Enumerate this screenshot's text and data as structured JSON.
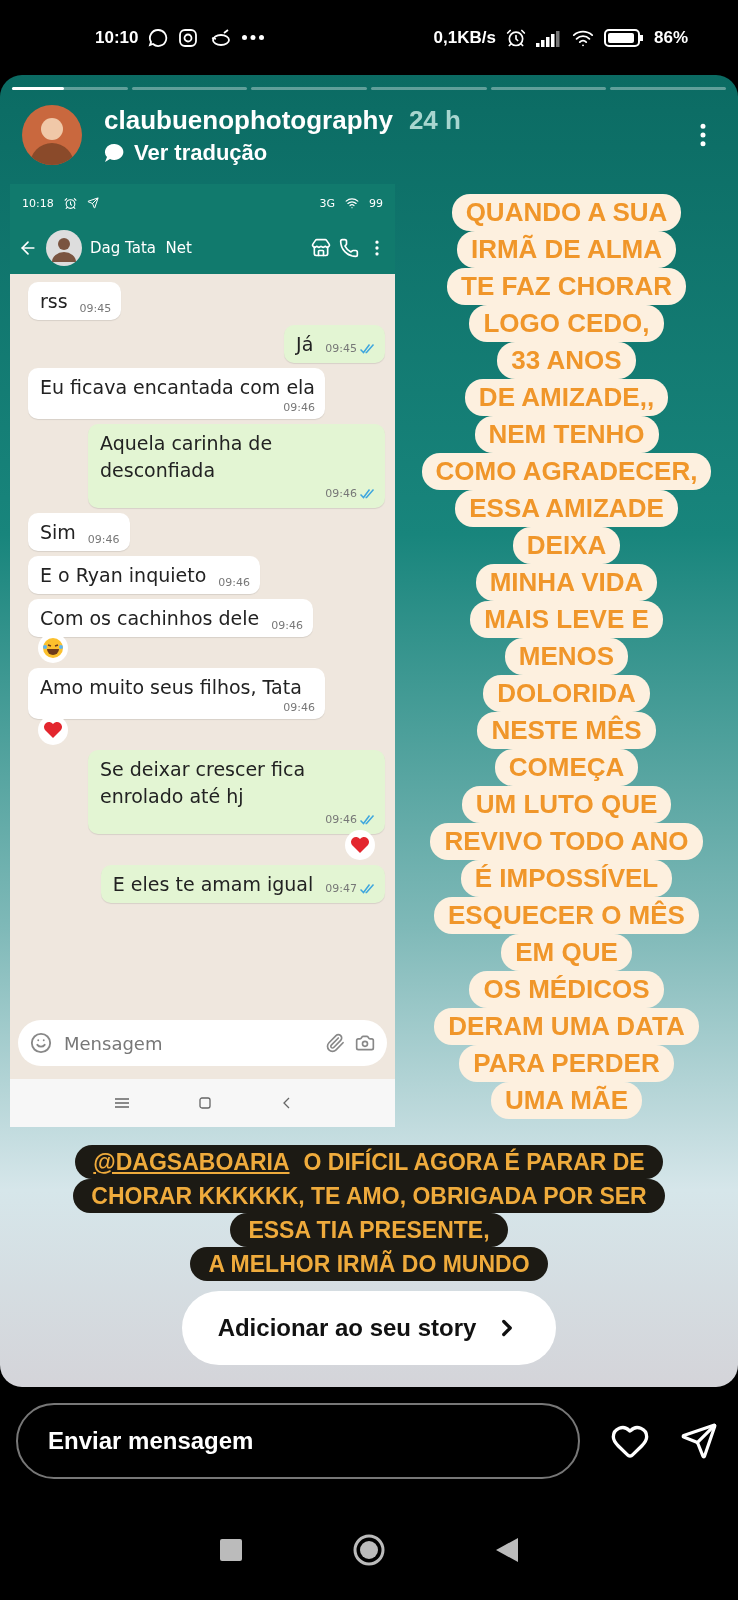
{
  "status_bar": {
    "time": "10:10",
    "speed": "0,1KB/s",
    "battery": "86%"
  },
  "story": {
    "progress": [
      {
        "level": 0.45
      },
      {
        "level": 0
      },
      {
        "level": 0
      },
      {
        "level": 0
      },
      {
        "level": 0
      },
      {
        "level": 0
      }
    ],
    "user": "claubuenophotography",
    "age": "24 h",
    "translate": "Ver tradução",
    "chat_screenshot": {
      "time": "10:18",
      "network": "3G",
      "battery": "99",
      "contact": "Dag Tata  Net",
      "messages": [
        {
          "kind": "in",
          "text": "rss",
          "time": "09:45"
        },
        {
          "kind": "out",
          "text": "Já",
          "time": "09:45",
          "read": true
        },
        {
          "kind": "in",
          "text": "Eu ficava encantada com ela",
          "time": "09:46"
        },
        {
          "kind": "out",
          "text": "Aquela carinha de desconfiada",
          "time": "09:46",
          "read": true
        },
        {
          "kind": "in",
          "text": "Sim",
          "time": "09:46"
        },
        {
          "kind": "in",
          "text": "E o Ryan inquieto",
          "time": "09:46"
        },
        {
          "kind": "in",
          "text": "Com os cachinhos dele",
          "time": "09:46",
          "reaction": {
            "kind": "laugh"
          }
        },
        {
          "kind": "in",
          "text": "Amo muito seus filhos, Tata",
          "time": "09:46",
          "reaction": {
            "kind": "heart"
          }
        },
        {
          "kind": "out",
          "text": "Se deixar crescer fica enrolado até hj",
          "time": "09:46",
          "read": true,
          "reaction": {
            "kind": "heart"
          }
        },
        {
          "kind": "out",
          "text": "E eles te amam igual",
          "time": "09:47",
          "read": true
        }
      ],
      "input": {
        "placeholder": "Mensagem"
      }
    },
    "text_lines": [
      "QUANDO A SUA",
      "IRMÃ DE ALMA",
      "TE FAZ CHORAR",
      "LOGO CEDO,",
      "33 ANOS",
      "DE AMIZADE,,",
      "NEM TENHO",
      "COMO AGRADECER,",
      "ESSA AMIZADE",
      "DEIXA",
      "MINHA VIDA",
      "MAIS LEVE E",
      "MENOS",
      "DOLORIDA",
      "NESTE MÊS",
      "COMEÇA",
      "UM LUTO QUE",
      "REVIVO TODO ANO",
      "É IMPOSSÍVEL",
      "ESQUECER O MÊS",
      "EM QUE",
      "OS MÉDICOS",
      "DERAM UMA DATA",
      "PARA PERDER",
      "UMA MÃE"
    ],
    "caption": {
      "mention": "@DAGSABOARIA",
      "lines": [
        "O DIFÍCIL AGORA É PARAR DE",
        "CHORAR KKKKKK, TE AMO, OBRIGADA POR SER",
        "ESSA TIA PRESENTE,",
        "A MELHOR IRMÃ DO MUNDO"
      ]
    },
    "add_button": "Adicionar ao seu story"
  },
  "reply": {
    "placeholder": "Enviar mensagem"
  }
}
